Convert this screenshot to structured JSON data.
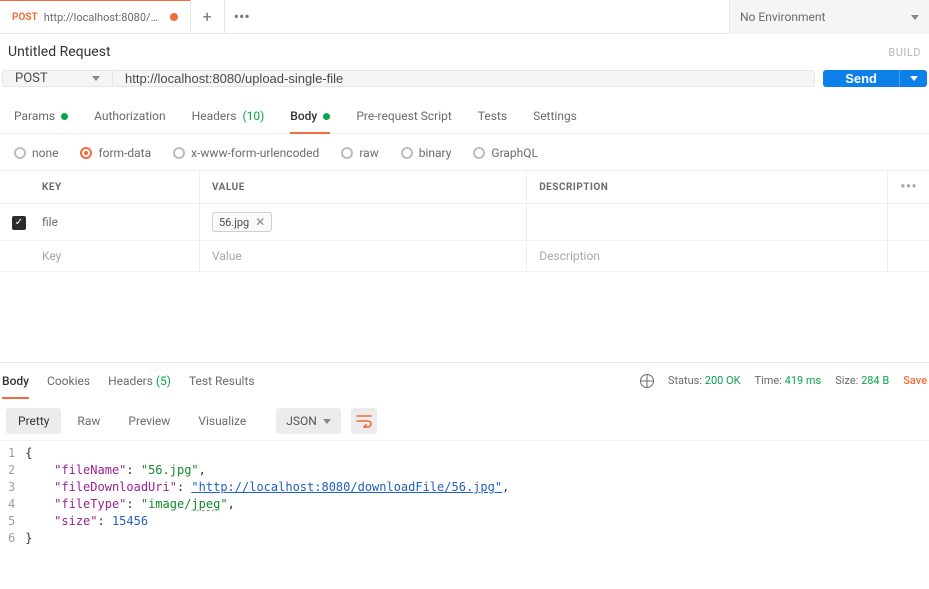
{
  "env": {
    "label": "No Environment"
  },
  "tab": {
    "method": "POST",
    "title": "http://localhost:8080/upload-s...",
    "dirty": true
  },
  "request": {
    "title": "Untitled Request",
    "build_label": "BUILD",
    "method": "POST",
    "url": "http://localhost:8080/upload-single-file",
    "send_label": "Send"
  },
  "req_tabs": {
    "params": "Params",
    "auth": "Authorization",
    "headers_label": "Headers",
    "headers_count": "(10)",
    "body": "Body",
    "prereq": "Pre-request Script",
    "tests": "Tests",
    "settings": "Settings"
  },
  "body_types": {
    "none": "none",
    "formdata": "form-data",
    "xform": "x-www-form-urlencoded",
    "raw": "raw",
    "binary": "binary",
    "graphql": "GraphQL"
  },
  "kv": {
    "headers": {
      "key": "KEY",
      "value": "VALUE",
      "desc": "DESCRIPTION"
    },
    "row": {
      "key": "file",
      "file": "56.jpg"
    },
    "placeholder": {
      "key": "Key",
      "value": "Value",
      "desc": "Description"
    }
  },
  "resp_tabs": {
    "body": "Body",
    "cookies": "Cookies",
    "headers_label": "Headers",
    "headers_count": "(5)",
    "tests": "Test Results"
  },
  "resp_meta": {
    "status_label": "Status:",
    "status_value": "200 OK",
    "time_label": "Time:",
    "time_value": "419 ms",
    "size_label": "Size:",
    "size_value": "284 B",
    "save": "Save"
  },
  "resp_toolbar": {
    "pretty": "Pretty",
    "raw": "Raw",
    "preview": "Preview",
    "visualize": "Visualize",
    "format": "JSON"
  },
  "resp_body": {
    "fileName_key": "\"fileName\"",
    "fileName_val": "\"56.jpg\"",
    "fileDownloadUri_key": "\"fileDownloadUri\"",
    "fileDownloadUri_val": "\"http://localhost:8080/downloadFile/56.jpg\"",
    "fileType_key": "\"fileType\"",
    "fileType_val_a": "\"image/",
    "fileType_val_b": "jpeg",
    "fileType_val_c": "\"",
    "size_key": "\"size\"",
    "size_val": "15456",
    "line1": "1",
    "line2": "2",
    "line3": "3",
    "line4": "4",
    "line5": "5",
    "line6": "6",
    "open": "{",
    "close": "}",
    "colon": ": ",
    "comma": ","
  }
}
